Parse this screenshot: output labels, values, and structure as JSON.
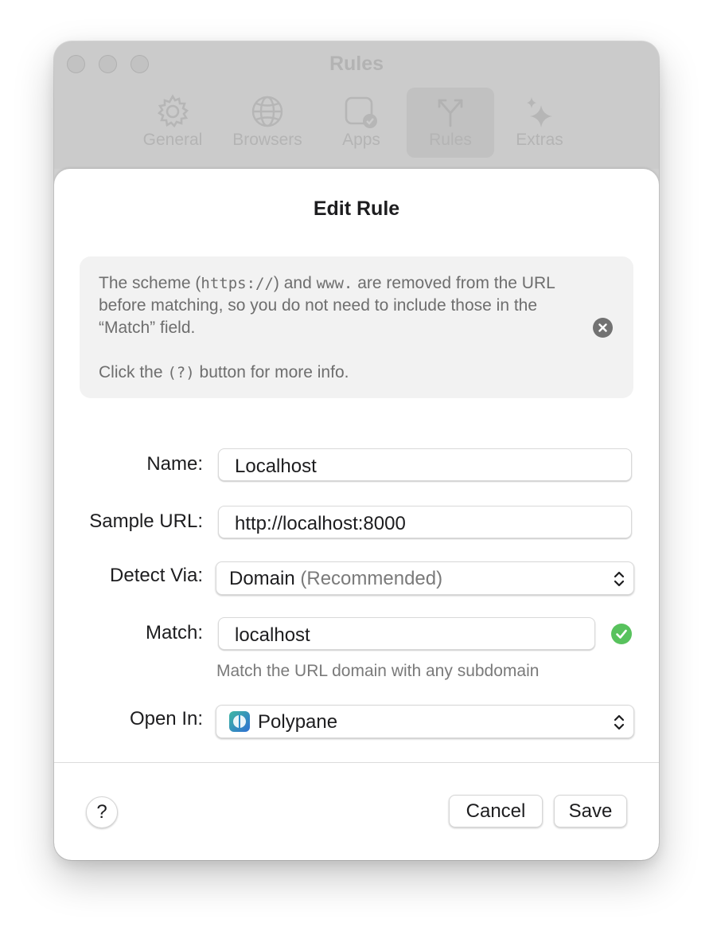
{
  "window": {
    "title": "Rules",
    "toolbar": [
      {
        "label": "General",
        "icon": "gear-icon"
      },
      {
        "label": "Browsers",
        "icon": "globe-icon"
      },
      {
        "label": "Apps",
        "icon": "apps-icon"
      },
      {
        "label": "Rules",
        "icon": "rules-icon",
        "selected": true
      },
      {
        "label": "Extras",
        "icon": "sparkles-icon"
      }
    ]
  },
  "sheet": {
    "title": "Edit Rule",
    "info": {
      "line1_a": "The scheme (",
      "line1_code1": "https://",
      "line1_b": ") and ",
      "line1_code2": "www.",
      "line1_c": " are removed from the URL before matching, so you do not need to include those in the “Match” field.",
      "line2_a": "Click the ",
      "line2_code": "(?)",
      "line2_b": " button for more info."
    },
    "fields": {
      "name_label": "Name:",
      "name_value": "Localhost",
      "sample_url_label": "Sample URL:",
      "sample_url_value": "http://localhost:8000",
      "detect_via_label": "Detect Via:",
      "detect_via_value": "Domain",
      "detect_via_note": "(Recommended)",
      "match_label": "Match:",
      "match_value": "localhost",
      "match_hint": "Match the URL domain with any subdomain",
      "open_in_label": "Open In:",
      "open_in_value": "Polypane"
    },
    "buttons": {
      "help": "?",
      "cancel": "Cancel",
      "save": "Save"
    }
  },
  "colors": {
    "valid_green": "#58c25d",
    "window_chrome": "#cbcbcb"
  }
}
